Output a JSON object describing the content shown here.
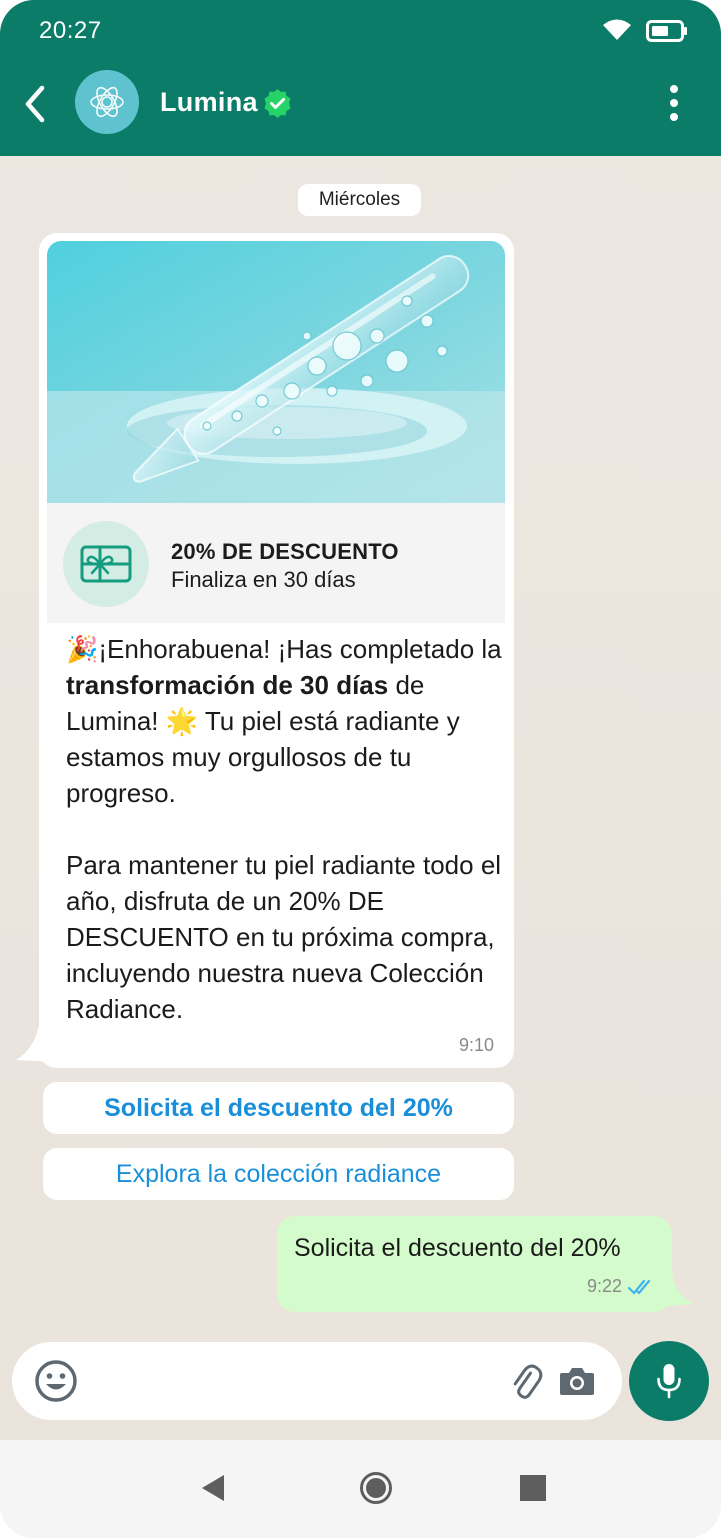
{
  "status_bar": {
    "time": "20:27"
  },
  "header": {
    "contact_name": "Lumina",
    "icons": [
      "back-arrow-icon",
      "brand-logo-icon",
      "verified-badge-icon",
      "more-options-icon"
    ]
  },
  "chat": {
    "date_chip": "Miércoles",
    "incoming": {
      "coupon": {
        "title": "20% DE DESCUENTO",
        "subtitle": "Finaliza en 30 días"
      },
      "text": {
        "p1_emoji": "🎉",
        "p1_a": "¡Enhorabuena! ¡Has completado la ",
        "p1_bold": "transformación de 30 días",
        "p1_b": " de Lumina! ",
        "p1_emoji2": "🌟",
        "p1_c": " Tu piel está radiante y estamos muy orgullosos de tu progreso.",
        "p2": "Para mantener tu piel radiante todo el año, disfruta de un 20% DE DESCUENTO en tu próxima compra, incluyendo nuestra nueva Colección Radiance."
      },
      "time": "9:10"
    },
    "quick_replies": [
      "Solicita el descuento del 20%",
      "Explora la colección radiance"
    ],
    "outgoing": {
      "text": "Solicita el descuento del 20%",
      "time": "9:22",
      "status": "read"
    }
  },
  "composer": {
    "placeholder": ""
  },
  "colors": {
    "header": "#0b7c68",
    "chat_background": "#ede7e1",
    "outgoing_bubble": "#d4fbcb",
    "link_blue": "#1a8fd9",
    "read_ticks": "#3fb4f0"
  }
}
